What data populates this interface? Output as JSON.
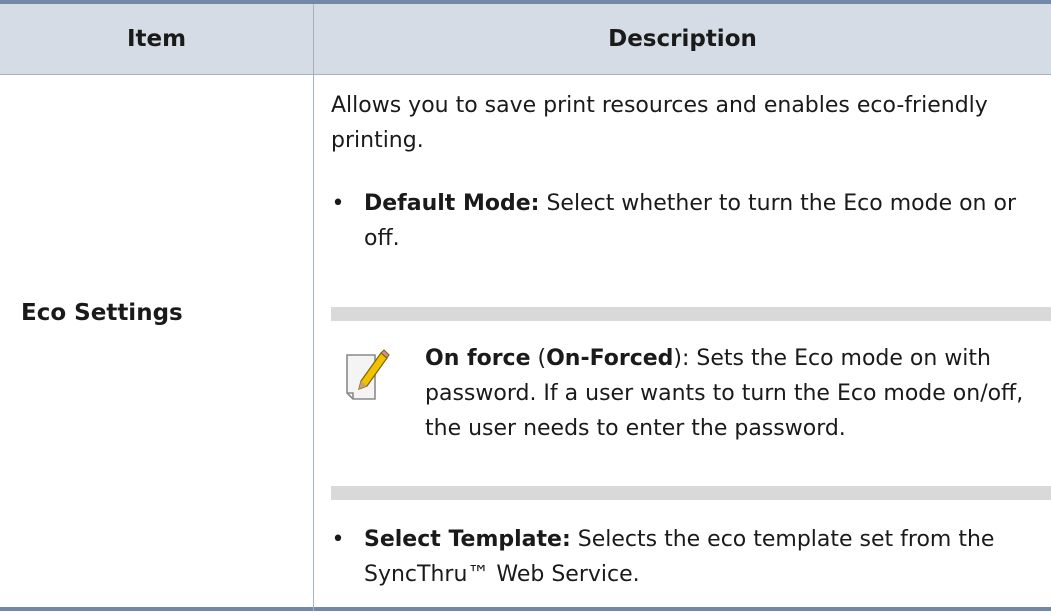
{
  "table": {
    "headers": {
      "item": "Item",
      "description": "Description"
    },
    "row": {
      "item": "Eco Settings",
      "intro": "Allows you to save print resources and enables eco-friendly printing.",
      "bullets": [
        {
          "bullet": "•",
          "bold": "Default Mode:",
          "text": " Select whether to turn the Eco mode on or off."
        },
        {
          "bullet": "•",
          "bold": "Select Template:",
          "text": " Selects the eco template set from the SyncThru™ Web Service."
        }
      ],
      "note": {
        "icon": "note-pencil-icon",
        "bold1": "On force",
        "paren_open": " (",
        "bold2": "On-Forced",
        "text": "): Sets the Eco mode on with password. If a user wants to turn the Eco mode on/off, the user needs to enter the password."
      }
    }
  },
  "colors": {
    "rule": "#7288a6",
    "header_bg": "#d6dce5",
    "note_bar": "#d9d9d9"
  }
}
